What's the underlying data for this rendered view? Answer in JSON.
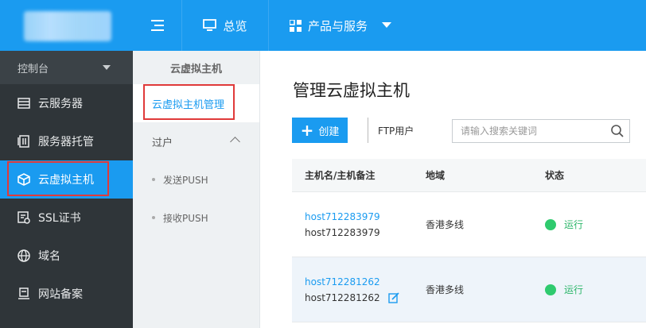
{
  "top": {
    "overview_label": "总览",
    "products_label": "产品与服务",
    "accent": "#1a9bf0"
  },
  "sidebar": {
    "console_label": "控制台",
    "items": [
      {
        "label": "云服务器",
        "icon": "server-icon"
      },
      {
        "label": "服务器托管",
        "icon": "hosting-icon"
      },
      {
        "label": "云虚拟主机",
        "icon": "cube-icon",
        "active": true
      },
      {
        "label": "SSL证书",
        "icon": "certificate-icon"
      },
      {
        "label": "域名",
        "icon": "globe-icon"
      },
      {
        "label": "网站备案",
        "icon": "record-icon"
      }
    ]
  },
  "subsidebar": {
    "title": "云虚拟主机",
    "active_item": "云虚拟主机管理",
    "group_label": "过户",
    "group_items": [
      "发送PUSH",
      "接收PUSH"
    ]
  },
  "main": {
    "title": "管理云虚拟主机",
    "create_label": "创建",
    "ftp_label": "FTP用户",
    "search_placeholder": "请输入搜索关键词",
    "columns": [
      "主机名/主机备注",
      "地域",
      "状态"
    ],
    "rows": [
      {
        "host": "host712283979",
        "note": "host712283979",
        "region": "香港多线",
        "status": "运行"
      },
      {
        "host": "host712281262",
        "note": "host712281262",
        "region": "香港多线",
        "status": "运行"
      }
    ]
  }
}
